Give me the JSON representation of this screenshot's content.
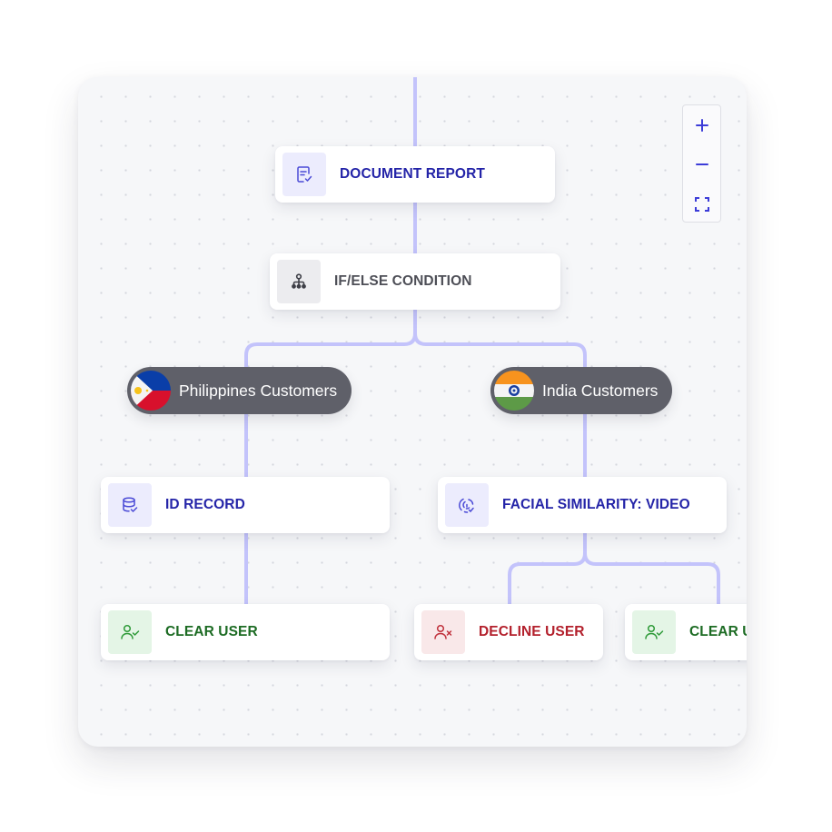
{
  "colors": {
    "connector": "#c3c3fb",
    "brand_blue": "#2424a8",
    "success_green": "#1c6b23",
    "danger_red": "#b3202c",
    "pill_bg": "#5f6069"
  },
  "zoom_controls": {
    "zoom_in_icon": "plus-icon",
    "zoom_out_icon": "minus-icon",
    "fit_icon": "fullscreen-icon"
  },
  "nodes": {
    "document_report": {
      "label": "DOCUMENT REPORT",
      "icon": "document-check-icon"
    },
    "if_else": {
      "label": "IF/ELSE CONDITION",
      "icon": "branch-icon"
    },
    "id_record": {
      "label": "ID RECORD",
      "icon": "database-check-icon"
    },
    "facial_similarity": {
      "label": "FACIAL SIMILARITY: VIDEO",
      "icon": "face-scan-icon"
    },
    "clear_user_left": {
      "label": "CLEAR USER",
      "icon": "user-check-icon"
    },
    "decline_user": {
      "label": "DECLINE USER",
      "icon": "user-x-icon"
    },
    "clear_user_right": {
      "label": "CLEAR USER",
      "icon": "user-check-icon"
    }
  },
  "branches": {
    "philippines": {
      "label": "Philippines Customers",
      "flag": "philippines-flag-icon"
    },
    "india": {
      "label": "India Customers",
      "flag": "india-flag-icon"
    }
  }
}
